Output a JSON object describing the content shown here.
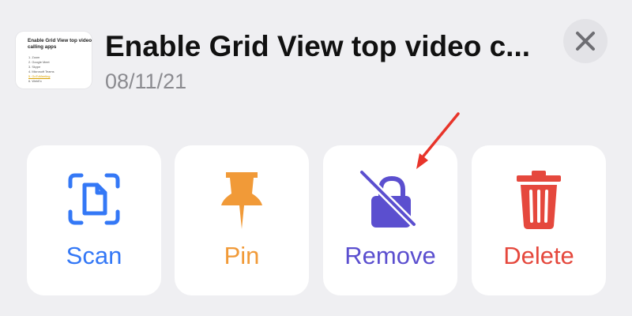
{
  "note": {
    "title": "Enable Grid View top video c...",
    "date": "08/11/21",
    "thumbnail": {
      "heading": "Enable Grid View top video calling apps",
      "items": [
        "1. Zoom",
        "2. Google Meet",
        "3. Skype",
        "4. Microsoft Teams",
        "5. GoToMeeting",
        "6. WebEx"
      ]
    }
  },
  "actions": {
    "scan": {
      "label": "Scan",
      "icon": "document-scan-icon",
      "color": "#3478f6"
    },
    "pin": {
      "label": "Pin",
      "icon": "pushpin-icon",
      "color": "#f19a38"
    },
    "remove": {
      "label": "Remove",
      "icon": "lock-slash-icon",
      "color": "#5b4fcf"
    },
    "delete": {
      "label": "Delete",
      "icon": "trash-icon",
      "color": "#e5483d"
    }
  },
  "close": {
    "icon": "close-icon"
  },
  "annotation": {
    "color": "#e8342a"
  }
}
